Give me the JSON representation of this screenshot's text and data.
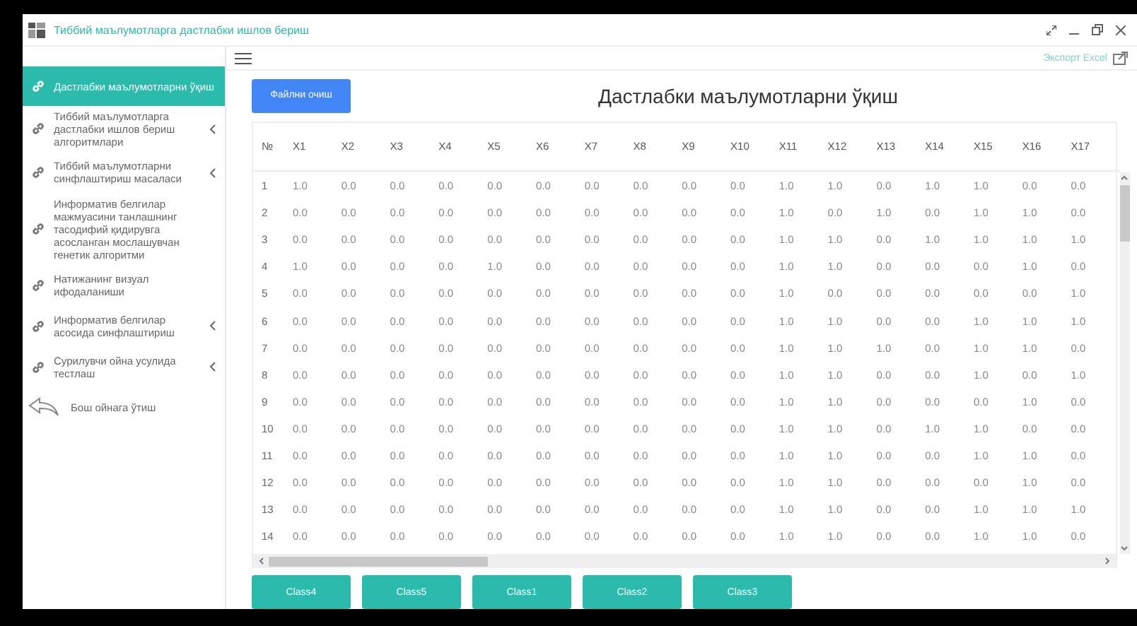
{
  "window": {
    "title": "Тиббий маълумотларга дастлабки ишлов бериш"
  },
  "sidebar": {
    "items": [
      {
        "label": "Дастлабки маълумотларни ўқиш",
        "selected": true,
        "expandable": false
      },
      {
        "label": "Тиббий маълумотларга дастлабки ишлов бериш алгоритмлари",
        "selected": false,
        "expandable": true
      },
      {
        "label": "Тиббий маълумотларни синфлаштириш масаласи",
        "selected": false,
        "expandable": true
      },
      {
        "label": "Информатив белгилар мажмуасини танлашнинг тасодифий қидирувга асосланган мослашувчан генетик алгоритми",
        "selected": false,
        "expandable": false
      },
      {
        "label": "Натижанинг визуал ифодаланиши",
        "selected": false,
        "expandable": false
      },
      {
        "label": "Информатив белгилар асосида синфлаштириш",
        "selected": false,
        "expandable": true
      },
      {
        "label": "Сурилувчи ойна усулида тестлаш",
        "selected": false,
        "expandable": true
      }
    ],
    "back": "Бош ойнага ўтиш"
  },
  "toolbar": {
    "export": "Экспорт Excel"
  },
  "open_button": "Файлни очиш",
  "heading": "Дастлабки маълумотларни ўқиш",
  "table": {
    "columns": [
      "№",
      "X1",
      "X2",
      "X3",
      "X4",
      "X5",
      "X6",
      "X7",
      "X8",
      "X9",
      "X10",
      "X11",
      "X12",
      "X13",
      "X14",
      "X15",
      "X16",
      "X17"
    ],
    "rows": [
      [
        "1",
        "1.0",
        "0.0",
        "0.0",
        "0.0",
        "0.0",
        "0.0",
        "0.0",
        "0.0",
        "0.0",
        "0.0",
        "1.0",
        "1.0",
        "0.0",
        "1.0",
        "1.0",
        "0.0",
        "0.0"
      ],
      [
        "2",
        "0.0",
        "0.0",
        "0.0",
        "0.0",
        "0.0",
        "0.0",
        "0.0",
        "0.0",
        "0.0",
        "0.0",
        "1.0",
        "0.0",
        "1.0",
        "0.0",
        "1.0",
        "1.0",
        "0.0"
      ],
      [
        "3",
        "0.0",
        "0.0",
        "0.0",
        "0.0",
        "0.0",
        "0.0",
        "0.0",
        "0.0",
        "0.0",
        "0.0",
        "1.0",
        "1.0",
        "0.0",
        "1.0",
        "1.0",
        "1.0",
        "1.0"
      ],
      [
        "4",
        "1.0",
        "0.0",
        "0.0",
        "0.0",
        "1.0",
        "0.0",
        "0.0",
        "0.0",
        "0.0",
        "0.0",
        "1.0",
        "1.0",
        "0.0",
        "0.0",
        "0.0",
        "1.0",
        "0.0"
      ],
      [
        "5",
        "0.0",
        "0.0",
        "0.0",
        "0.0",
        "0.0",
        "0.0",
        "0.0",
        "0.0",
        "0.0",
        "0.0",
        "1.0",
        "0.0",
        "0.0",
        "0.0",
        "0.0",
        "0.0",
        "1.0"
      ],
      [
        "6",
        "0.0",
        "0.0",
        "0.0",
        "0.0",
        "0.0",
        "0.0",
        "0.0",
        "0.0",
        "0.0",
        "0.0",
        "1.0",
        "1.0",
        "0.0",
        "0.0",
        "1.0",
        "1.0",
        "1.0"
      ],
      [
        "7",
        "0.0",
        "0.0",
        "0.0",
        "0.0",
        "0.0",
        "0.0",
        "0.0",
        "0.0",
        "0.0",
        "0.0",
        "1.0",
        "1.0",
        "1.0",
        "0.0",
        "1.0",
        "1.0",
        "0.0"
      ],
      [
        "8",
        "0.0",
        "0.0",
        "0.0",
        "0.0",
        "0.0",
        "0.0",
        "0.0",
        "0.0",
        "0.0",
        "0.0",
        "1.0",
        "1.0",
        "0.0",
        "0.0",
        "1.0",
        "0.0",
        "1.0"
      ],
      [
        "9",
        "0.0",
        "0.0",
        "0.0",
        "0.0",
        "0.0",
        "0.0",
        "0.0",
        "0.0",
        "0.0",
        "0.0",
        "1.0",
        "1.0",
        "0.0",
        "0.0",
        "0.0",
        "1.0",
        "0.0"
      ],
      [
        "10",
        "0.0",
        "0.0",
        "0.0",
        "0.0",
        "0.0",
        "0.0",
        "0.0",
        "0.0",
        "0.0",
        "0.0",
        "1.0",
        "1.0",
        "0.0",
        "1.0",
        "1.0",
        "0.0",
        "0.0"
      ],
      [
        "11",
        "0.0",
        "0.0",
        "0.0",
        "0.0",
        "0.0",
        "0.0",
        "0.0",
        "0.0",
        "0.0",
        "0.0",
        "1.0",
        "1.0",
        "0.0",
        "0.0",
        "1.0",
        "1.0",
        "0.0"
      ],
      [
        "12",
        "0.0",
        "0.0",
        "0.0",
        "0.0",
        "0.0",
        "0.0",
        "0.0",
        "0.0",
        "0.0",
        "0.0",
        "1.0",
        "1.0",
        "0.0",
        "0.0",
        "0.0",
        "1.0",
        "0.0"
      ],
      [
        "13",
        "0.0",
        "0.0",
        "0.0",
        "0.0",
        "0.0",
        "0.0",
        "0.0",
        "0.0",
        "0.0",
        "0.0",
        "1.0",
        "1.0",
        "0.0",
        "0.0",
        "1.0",
        "1.0",
        "1.0"
      ],
      [
        "14",
        "0.0",
        "0.0",
        "0.0",
        "0.0",
        "0.0",
        "0.0",
        "0.0",
        "0.0",
        "0.0",
        "0.0",
        "1.0",
        "1.0",
        "0.0",
        "0.0",
        "1.0",
        "1.0",
        "0.0"
      ]
    ]
  },
  "class_buttons": [
    "Class4",
    "Class5",
    "Class1",
    "Class2",
    "Class3"
  ]
}
